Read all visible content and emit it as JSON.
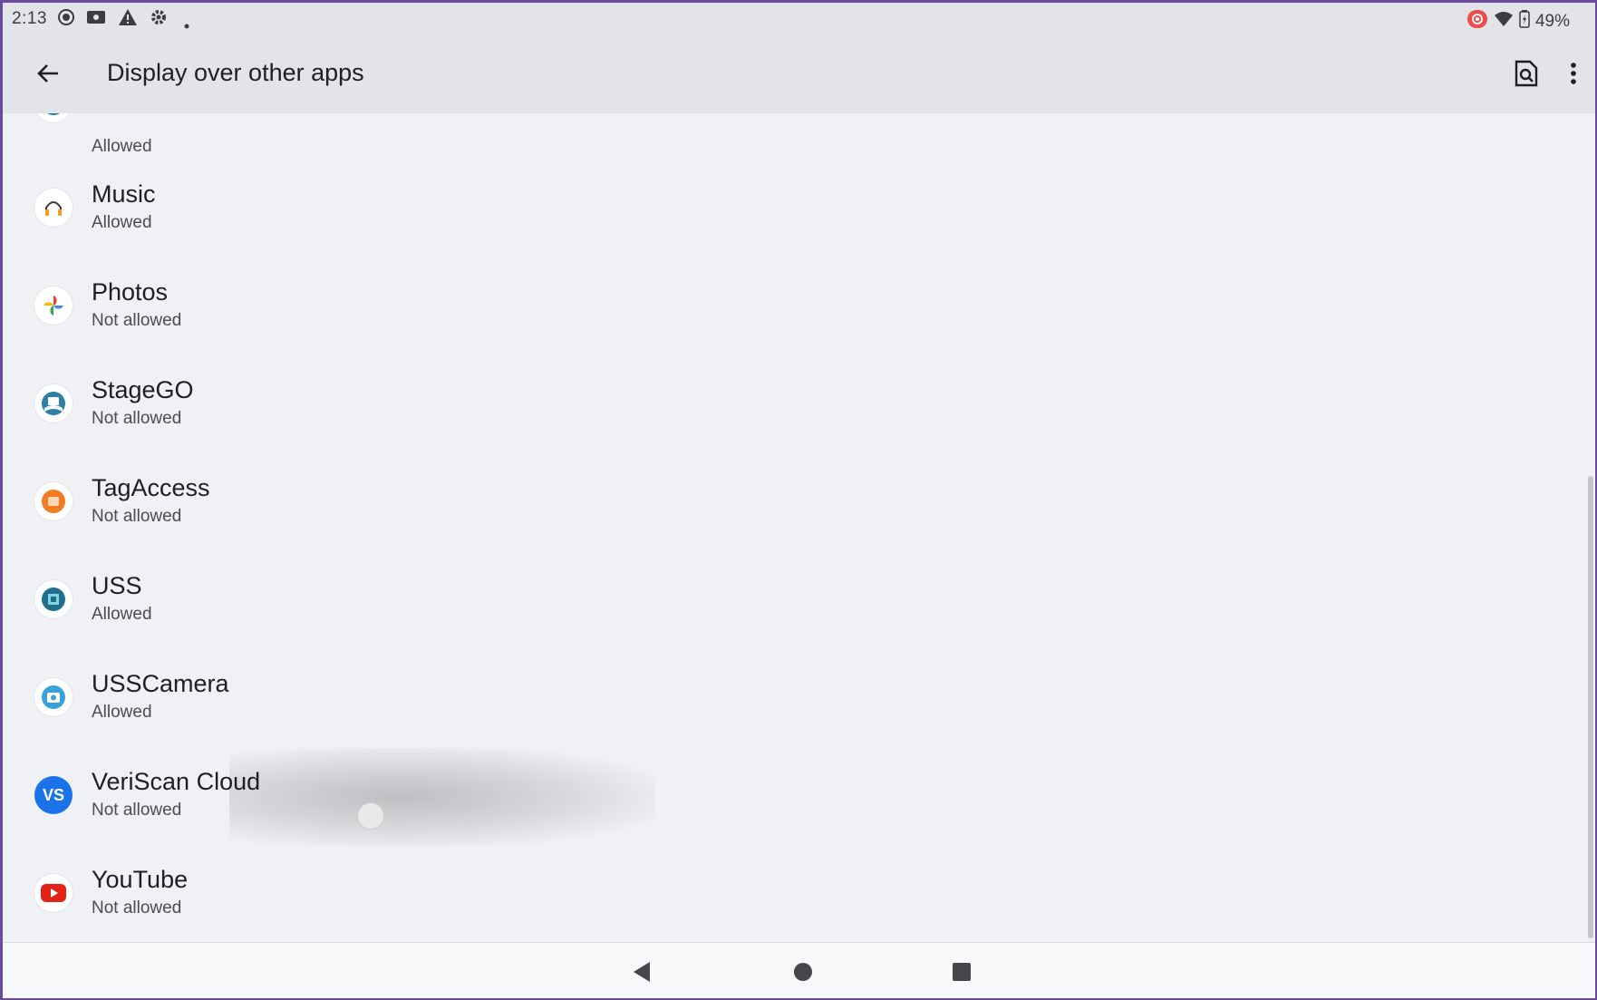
{
  "status_bar": {
    "time": "2:13",
    "battery": "49%",
    "icons_left": [
      "screen-record-icon",
      "cast-icon",
      "warning-icon",
      "settings-icon",
      "dot-icon"
    ],
    "icons_right": [
      "record-indicator-icon",
      "wifi-icon",
      "battery-icon"
    ]
  },
  "app_bar": {
    "title": "Display over other apps",
    "back_icon": "arrow-back-icon",
    "search_icon": "search-in-page-icon",
    "menu_icon": "more-vert-icon"
  },
  "apps": [
    {
      "name": "",
      "status": "Allowed",
      "icon": "app-icon-partial"
    },
    {
      "name": "Music",
      "status": "Allowed",
      "icon": "headphones-icon"
    },
    {
      "name": "Photos",
      "status": "Not allowed",
      "icon": "pinwheel-icon"
    },
    {
      "name": "StageGO",
      "status": "Not allowed",
      "icon": "stagego-icon"
    },
    {
      "name": "TagAccess",
      "status": "Not allowed",
      "icon": "tagaccess-icon"
    },
    {
      "name": "USS",
      "status": "Allowed",
      "icon": "uss-icon"
    },
    {
      "name": "USSCamera",
      "status": "Allowed",
      "icon": "usscamera-icon"
    },
    {
      "name": "VeriScan Cloud",
      "status": "Not allowed",
      "icon": "veriscan-icon",
      "icon_text": "VS"
    },
    {
      "name": "YouTube",
      "status": "Not allowed",
      "icon": "youtube-icon"
    }
  ],
  "nav_bar": {
    "back": "nav-back-icon",
    "home": "nav-home-icon",
    "recents": "nav-recents-icon"
  },
  "colors": {
    "background": "#eff1f4",
    "bar": "#e2e4e7",
    "veriscan_blue": "#1a73e8",
    "youtube_red": "#e62117"
  }
}
